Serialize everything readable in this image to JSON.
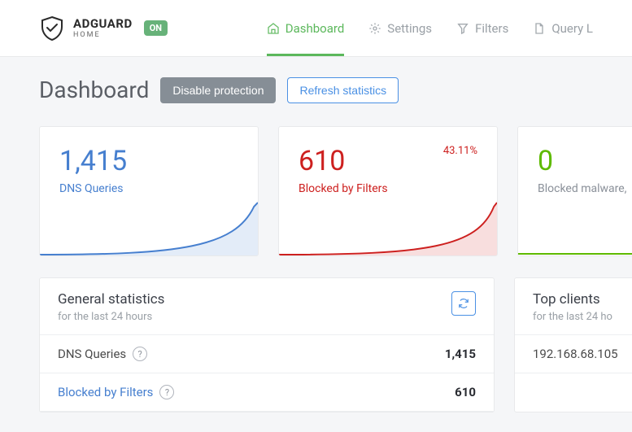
{
  "brand": {
    "main": "ADGUARD",
    "sub": "HOME",
    "status": "ON"
  },
  "nav": {
    "dashboard": "Dashboard",
    "settings": "Settings",
    "filters": "Filters",
    "queryLog": "Query L"
  },
  "page": {
    "title": "Dashboard",
    "disable_btn": "Disable protection",
    "refresh_btn": "Refresh statistics"
  },
  "cards": {
    "queries": {
      "value": "1,415",
      "label": "DNS Queries"
    },
    "blocked": {
      "value": "610",
      "label": "Blocked by Filters",
      "pct": "43.11%"
    },
    "malware": {
      "value": "0",
      "label": "Blocked malware,"
    }
  },
  "stats": {
    "title": "General statistics",
    "sub": "for the last 24 hours",
    "rows": {
      "queries": {
        "label": "DNS Queries",
        "value": "1,415"
      },
      "blocked": {
        "label": "Blocked by Filters",
        "value": "610"
      }
    }
  },
  "clients": {
    "title": "Top clients",
    "sub": "for the last 24 ho",
    "item1": "192.168.68.105"
  }
}
